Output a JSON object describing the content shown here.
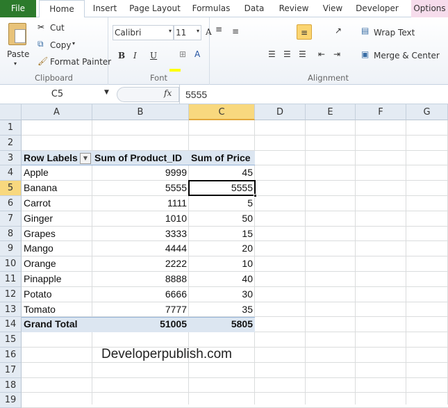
{
  "tabs": [
    "File",
    "Home",
    "Insert",
    "Page Layout",
    "Formulas",
    "Data",
    "Review",
    "View",
    "Developer",
    "Options"
  ],
  "clipboard": {
    "paste": "Paste",
    "cut": "Cut",
    "copy": "Copy",
    "format_painter": "Format Painter",
    "label": "Clipboard"
  },
  "font": {
    "name": "Calibri",
    "size": "11",
    "bold": "B",
    "italic": "I",
    "underline": "U",
    "font_color": "A",
    "label": "Font",
    "highlight_color": "#ffff00",
    "font_color_hex": "#e00000"
  },
  "alignment": {
    "wrap": "Wrap Text",
    "merge": "Merge & Center",
    "label": "Alignment"
  },
  "formula_bar": {
    "name_box": "C5",
    "fx": "fx",
    "value": "5555"
  },
  "columns": [
    "A",
    "B",
    "C",
    "D",
    "E",
    "F",
    "G"
  ],
  "rows": [
    "1",
    "2",
    "3",
    "4",
    "5",
    "6",
    "7",
    "8",
    "9",
    "10",
    "11",
    "12",
    "13",
    "14",
    "15",
    "16",
    "17",
    "18",
    "19"
  ],
  "pivot": {
    "headers": [
      "Row Labels",
      "Sum of Product_ID",
      "Sum of Price"
    ],
    "items": [
      {
        "label": "Apple",
        "id": "9999",
        "price": "45"
      },
      {
        "label": "Banana",
        "id": "5555",
        "price": "5555"
      },
      {
        "label": "Carrot",
        "id": "1111",
        "price": "5"
      },
      {
        "label": "Ginger",
        "id": "1010",
        "price": "50"
      },
      {
        "label": "Grapes",
        "id": "3333",
        "price": "15"
      },
      {
        "label": "Mango",
        "id": "4444",
        "price": "20"
      },
      {
        "label": "Orange",
        "id": "2222",
        "price": "10"
      },
      {
        "label": "Pinapple",
        "id": "8888",
        "price": "40"
      },
      {
        "label": "Potato",
        "id": "6666",
        "price": "30"
      },
      {
        "label": "Tomato",
        "id": "7777",
        "price": "35"
      }
    ],
    "total": {
      "label": "Grand Total",
      "id": "51005",
      "price": "5805"
    }
  },
  "watermark": "Developerpublish.com"
}
